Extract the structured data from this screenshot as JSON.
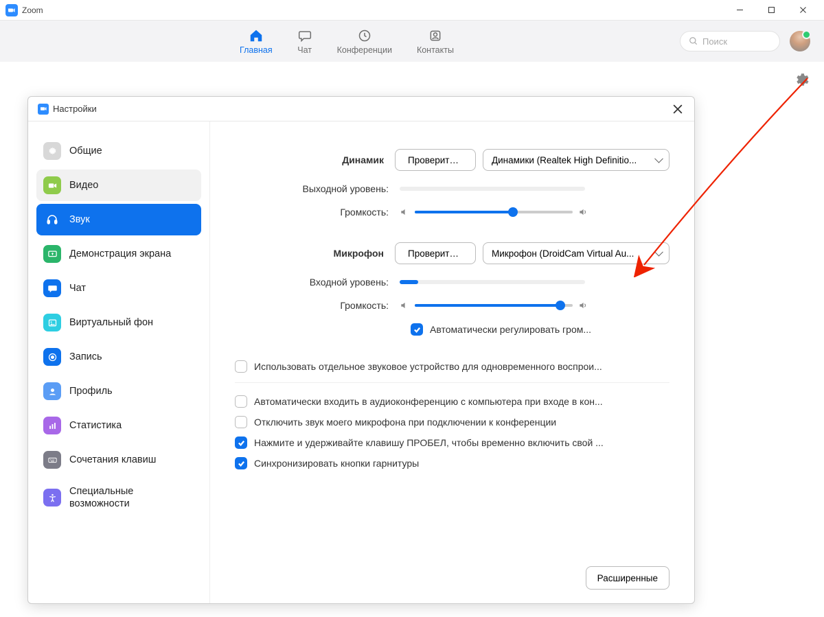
{
  "titlebar": {
    "title": "Zoom"
  },
  "topnav": {
    "tabs": [
      {
        "label": "Главная"
      },
      {
        "label": "Чат"
      },
      {
        "label": "Конференции"
      },
      {
        "label": "Контакты"
      }
    ],
    "search_placeholder": "Поиск"
  },
  "modal": {
    "title": "Настройки",
    "sidebar": [
      {
        "label": "Общие"
      },
      {
        "label": "Видео"
      },
      {
        "label": "Звук"
      },
      {
        "label": "Демонстрация экрана"
      },
      {
        "label": "Чат"
      },
      {
        "label": "Виртуальный фон"
      },
      {
        "label": "Запись"
      },
      {
        "label": "Профиль"
      },
      {
        "label": "Статистика"
      },
      {
        "label": "Сочетания клавиш"
      },
      {
        "label": "Специальные возможности"
      }
    ],
    "audio": {
      "speaker_label": "Динамик",
      "test_button": "Проверить ...",
      "speaker_device": "Динамики (Realtek High Definitio...",
      "output_level_label": "Выходной уровень:",
      "volume_label": "Громкость:",
      "speaker_volume_pct": 62,
      "mic_label": "Микрофон",
      "mic_device": "Микрофон (DroidCam Virtual Au...",
      "input_level_label": "Входной уровень:",
      "input_level_pct": 10,
      "mic_volume_pct": 92,
      "auto_adjust": "Автоматически регулировать гром...",
      "separate_device": "Использовать отдельное звуковое устройство для одновременного воспрои...",
      "auto_join": "Автоматически входить в аудиоконференцию с компьютера при входе в кон...",
      "mute_on_join": "Отключить звук моего микрофона при подключении к конференции",
      "push_to_talk": "Нажмите и удерживайте клавишу ПРОБЕЛ, чтобы временно включить свой ...",
      "sync_headset": "Синхронизировать кнопки гарнитуры",
      "advanced": "Расширенные"
    }
  },
  "icons": {
    "general": {
      "bg": "#d8d8d8"
    },
    "video": {
      "bg": "#8FCB4B"
    },
    "audio": {
      "bg": "#0E72ED"
    },
    "share": {
      "bg": "#2BB56A"
    },
    "chat": {
      "bg": "#0E72ED"
    },
    "vbg": {
      "bg": "#2ECEE2"
    },
    "record": {
      "bg": "#0E72ED"
    },
    "profile": {
      "bg": "#5B9DF5"
    },
    "stats": {
      "bg": "#A868E8"
    },
    "keyboard": {
      "bg": "#7C7C88"
    },
    "accessibility": {
      "bg": "#7B6FF0"
    }
  }
}
